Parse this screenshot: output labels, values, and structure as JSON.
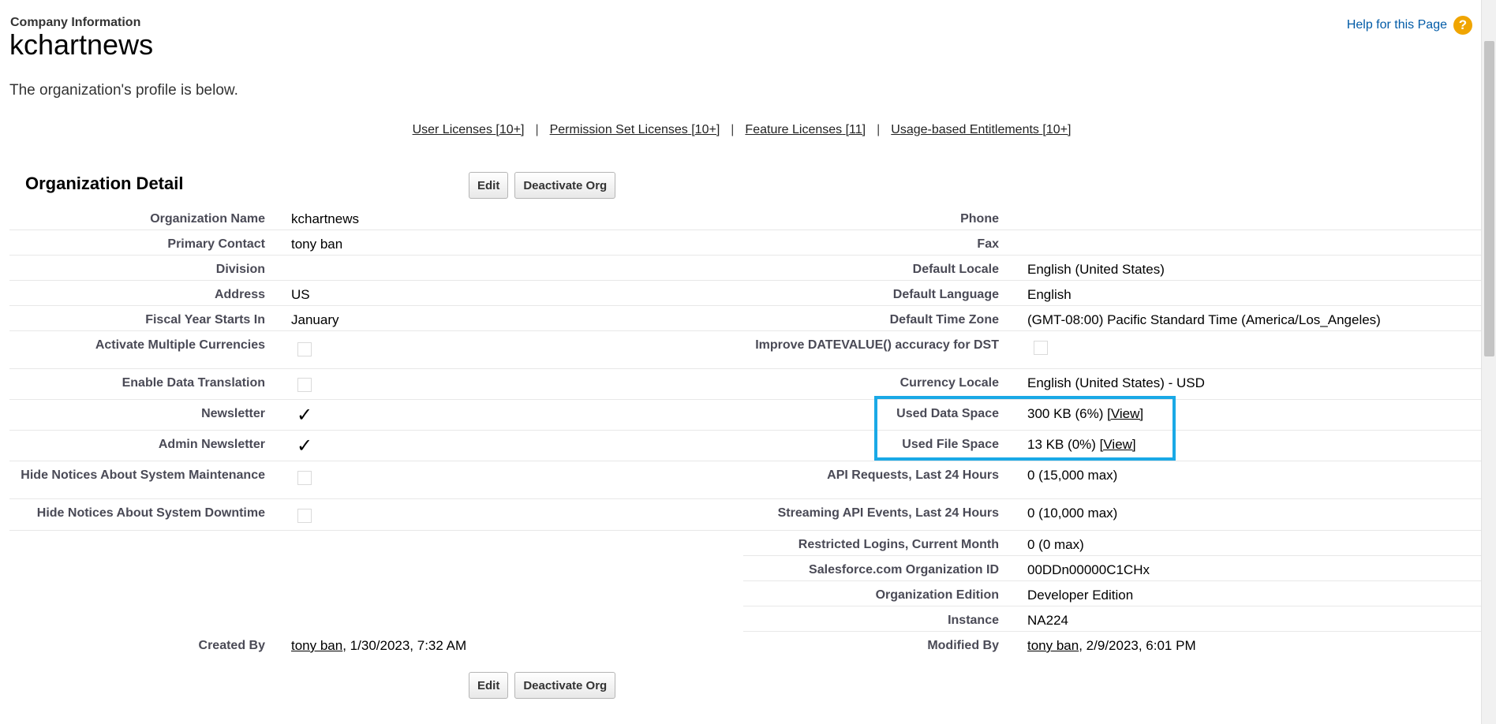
{
  "header": {
    "supertitle": "Company Information",
    "title": "kchartnews",
    "help_link": "Help for this Page",
    "help_icon": "help-icon",
    "intro": "The organization's profile is below."
  },
  "license_links": [
    {
      "label": "User Licenses",
      "count": "[10+]"
    },
    {
      "label": "Permission Set Licenses",
      "count": "[10+]"
    },
    {
      "label": "Feature Licenses",
      "count": "[11]"
    },
    {
      "label": "Usage-based Entitlements",
      "count": "[10+]"
    }
  ],
  "license_separator": "|",
  "section": {
    "title": "Organization Detail",
    "edit_label": "Edit",
    "deactivate_label": "Deactivate Org"
  },
  "left": {
    "org_name_label": "Organization Name",
    "org_name": "kchartnews",
    "primary_contact_label": "Primary Contact",
    "primary_contact": "tony ban",
    "division_label": "Division",
    "division": "",
    "address_label": "Address",
    "address": "US",
    "fiscal_label": "Fiscal Year Starts In",
    "fiscal": "January",
    "multi_currency_label": "Activate Multiple Currencies",
    "multi_currency": false,
    "data_translation_label": "Enable Data Translation",
    "data_translation": false,
    "newsletter_label": "Newsletter",
    "newsletter": true,
    "admin_newsletter_label": "Admin Newsletter",
    "admin_newsletter": true,
    "hide_maintenance_label": "Hide Notices About System Maintenance",
    "hide_maintenance": false,
    "hide_downtime_label": "Hide Notices About System Downtime",
    "hide_downtime": false,
    "created_by_label": "Created By",
    "created_by_user": "tony ban",
    "created_by_date": ", 1/30/2023, 7:32 AM"
  },
  "right": {
    "phone_label": "Phone",
    "phone": "",
    "fax_label": "Fax",
    "fax": "",
    "locale_label": "Default Locale",
    "locale": "English (United States)",
    "language_label": "Default Language",
    "language": "English",
    "timezone_label": "Default Time Zone",
    "timezone": "(GMT-08:00) Pacific Standard Time (America/Los_Angeles)",
    "datevalue_label": "Improve DATEVALUE() accuracy for DST",
    "datevalue": false,
    "currency_label": "Currency Locale",
    "currency": "English (United States) - USD",
    "data_space_label": "Used Data Space",
    "data_space": "300 KB (6%)",
    "data_space_link": "[View]",
    "file_space_label": "Used File Space",
    "file_space": "13 KB (0%)",
    "file_space_link": "[View]",
    "api_label": "API Requests, Last 24 Hours",
    "api": "0 (15,000 max)",
    "streaming_label": "Streaming API Events, Last 24 Hours",
    "streaming": "0 (10,000 max)",
    "restricted_label": "Restricted Logins, Current Month",
    "restricted": "0 (0 max)",
    "org_id_label": "Salesforce.com Organization ID",
    "org_id": "00DDn00000C1CHx",
    "edition_label": "Organization Edition",
    "edition": "Developer Edition",
    "instance_label": "Instance",
    "instance": "NA224",
    "modified_by_label": "Modified By",
    "modified_by_user": "tony ban",
    "modified_by_date": ", 2/9/2023, 6:01 PM"
  },
  "highlight_color": "#1aa9e6"
}
